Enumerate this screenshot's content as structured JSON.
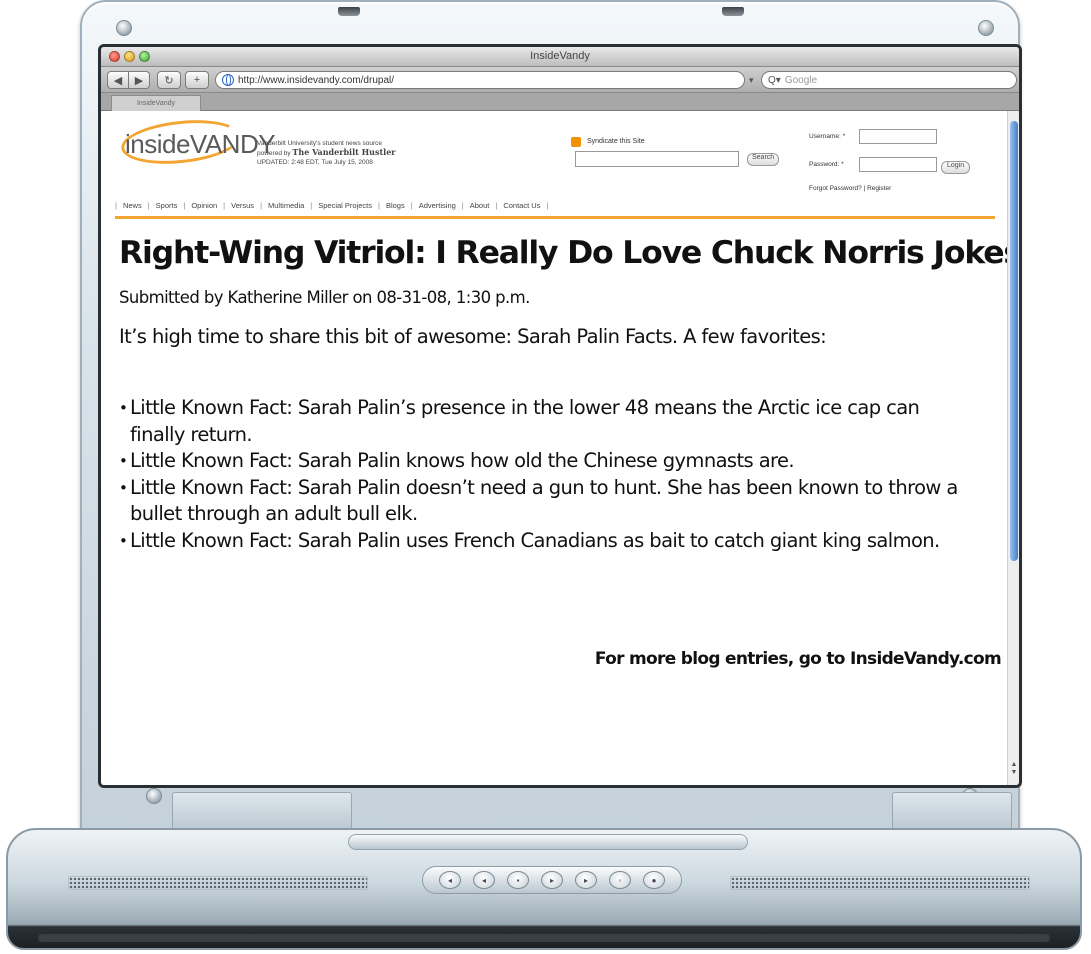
{
  "browser": {
    "window_title": "InsideVandy",
    "url": "http://www.insidevandy.com/drupal/",
    "search_placeholder": "Google",
    "tab_label": "InsideVandy"
  },
  "site": {
    "logo_text": "insideVANDY",
    "tagline_line1": "Vanderbilt University's student news source",
    "tagline_line2_prefix": "powered by ",
    "tagline_line2_paper": "The Vanderbilt Hustler",
    "tagline_line3": "UPDATED: 2:48 EDT, Tue July 15, 2008",
    "syndicate": "Syndicate this Site",
    "search_button": "Search",
    "username_label": "Username: *",
    "password_label": "Password: *",
    "login_button": "Login",
    "forgot_password": "Forgot Password?",
    "register": "Register",
    "nav": [
      "News",
      "Sports",
      "Opinion",
      "Versus",
      "Multimedia",
      "Special Projects",
      "Blogs",
      "Advertising",
      "About",
      "Contact Us"
    ]
  },
  "article": {
    "title": "Right-Wing Vitriol: I Really Do Love Chuck Norris Jokes",
    "byline": "Submitted by Katherine Miller on 08-31-08, 1:30 p.m.",
    "intro": "It’s high time to share this bit of awesome: Sarah Palin Facts. A few favorites:",
    "facts": [
      "Little Known Fact: Sarah Palin’s presence in the lower 48 means the Arctic ice cap can finally return.",
      "Little Known Fact: Sarah Palin knows how old the Chinese gymnasts are.",
      "Little Known Fact: Sarah Palin doesn’t need a gun to hunt.  She has been known to throw a bullet through an adult bull elk.",
      "Little Known Fact: Sarah Palin uses French Canadians as bait to catch giant king salmon."
    ],
    "more_link": "For more blog entries, go to InsideVandy.com"
  },
  "colors": {
    "accent": "#f3a431",
    "text": "#111111",
    "bezel": "#c4d1da"
  }
}
